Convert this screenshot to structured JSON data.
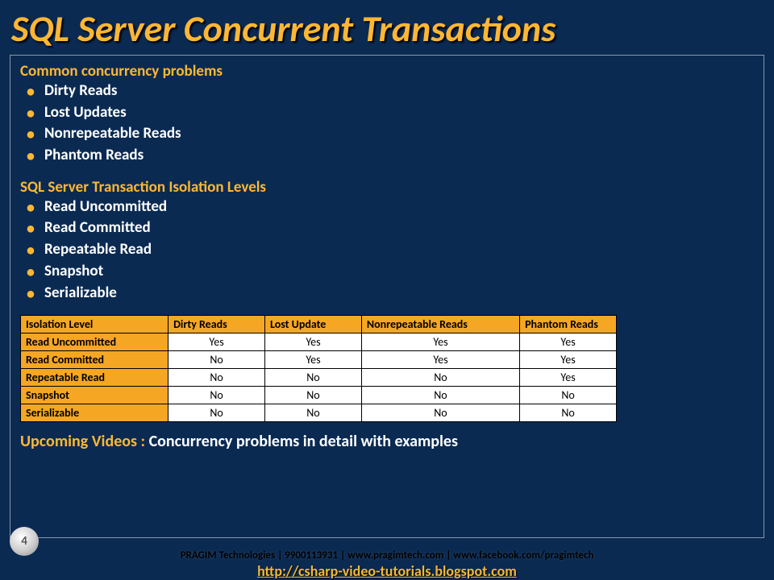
{
  "title": "SQL Server Concurrent Transactions",
  "section1": {
    "heading": "Common concurrency problems",
    "items": [
      "Dirty Reads",
      "Lost Updates",
      "Nonrepeatable Reads",
      "Phantom Reads"
    ]
  },
  "section2": {
    "heading": "SQL Server Transaction Isolation Levels",
    "items": [
      "Read Uncommitted",
      "Read Committed",
      "Repeatable Read",
      "Snapshot",
      "Serializable"
    ]
  },
  "table": {
    "headers": [
      "Isolation Level",
      "Dirty Reads",
      "Lost Update",
      "Nonrepeatable Reads",
      "Phantom Reads"
    ],
    "rows": [
      {
        "label": "Read Uncommitted",
        "cells": [
          "Yes",
          "Yes",
          "Yes",
          "Yes"
        ]
      },
      {
        "label": "Read Committed",
        "cells": [
          "No",
          "Yes",
          "Yes",
          "Yes"
        ]
      },
      {
        "label": "Repeatable Read",
        "cells": [
          "No",
          "No",
          "No",
          "Yes"
        ]
      },
      {
        "label": "Snapshot",
        "cells": [
          "No",
          "No",
          "No",
          "No"
        ]
      },
      {
        "label": "Serializable",
        "cells": [
          "No",
          "No",
          "No",
          "No"
        ]
      }
    ]
  },
  "upcoming": {
    "label": "Upcoming Videos : ",
    "text": "Concurrency problems in detail with examples"
  },
  "footer": {
    "pragim": "PRAGIM Technologies | 9900113931 | www.pragimtech.com | www.facebook.com/pragimtech",
    "blog": "http://csharp-video-tutorials.blogspot.com",
    "page": "4"
  }
}
